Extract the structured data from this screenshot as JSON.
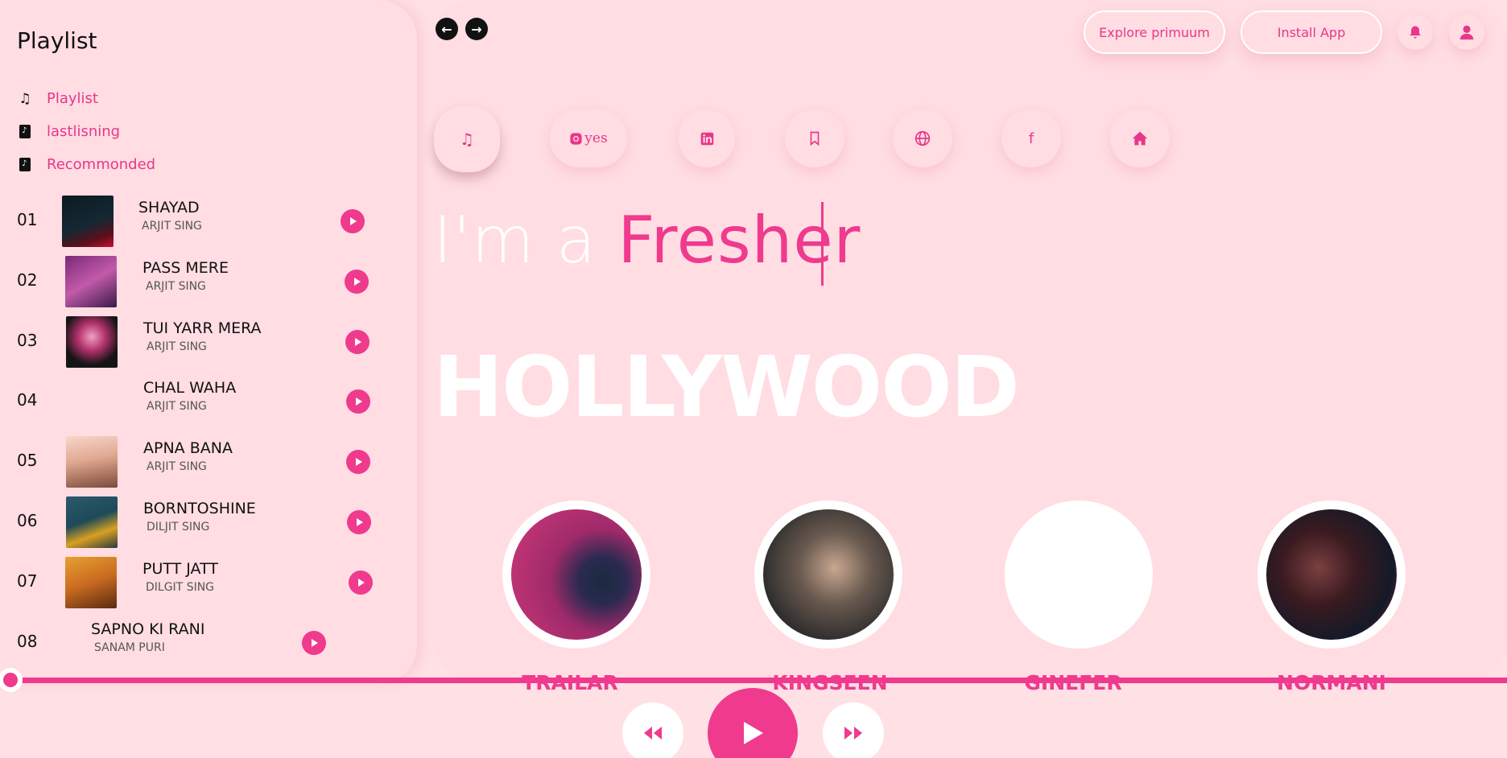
{
  "sidebar": {
    "title": "Playlist",
    "nav": [
      {
        "label": "Playlist",
        "icon": "music-note-icon"
      },
      {
        "label": "lastlisning",
        "icon": "music-file-icon"
      },
      {
        "label": "Recommonded",
        "icon": "music-file-icon"
      }
    ],
    "songs": [
      {
        "num": "01",
        "title": "SHAYAD",
        "artist": "ARJIT SING"
      },
      {
        "num": "02",
        "title": "PASS MERE",
        "artist": "ARJIT SING"
      },
      {
        "num": "03",
        "title": "TUI YARR MERA",
        "artist": "ARJIT SING"
      },
      {
        "num": "04",
        "title": "CHAL WAHA",
        "artist": "ARJIT SING"
      },
      {
        "num": "05",
        "title": "APNA BANA",
        "artist": "ARJIT SING"
      },
      {
        "num": "06",
        "title": "BORNTOSHINE",
        "artist": "DILJIT SING"
      },
      {
        "num": "07",
        "title": "PUTT JATT",
        "artist": "DILGIT SING"
      },
      {
        "num": "08",
        "title": "SAPNO KI RANI",
        "artist": "SANAM PURI"
      }
    ]
  },
  "header": {
    "explore_label": "Explore primuum",
    "install_label": "Install App"
  },
  "social": {
    "instagram_text": "yes"
  },
  "hero": {
    "prefix": "I'm a ",
    "accent": "Fresher",
    "big_word": "HOLLYWOOD"
  },
  "artists": [
    {
      "name": "TRAILAR"
    },
    {
      "name": "KINGSEEN"
    },
    {
      "name": "GINEFER"
    },
    {
      "name": "NORMANI"
    }
  ],
  "colors": {
    "background": "#ffe0e5",
    "accent": "#ef3a8e"
  }
}
